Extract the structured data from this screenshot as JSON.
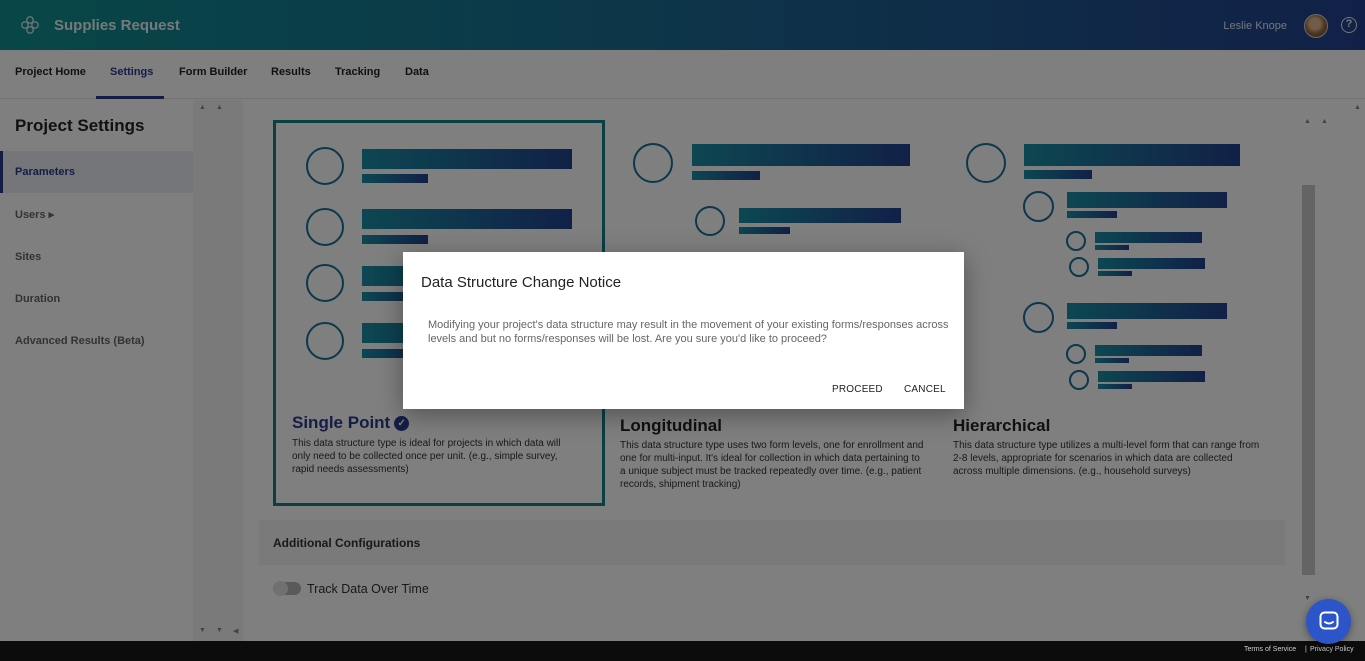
{
  "header": {
    "app_title": "Supplies Request",
    "user_name": "Leslie Knope",
    "help_label": "?"
  },
  "tabs": [
    {
      "label": "Project Home"
    },
    {
      "label": "Settings",
      "active": true
    },
    {
      "label": "Form Builder"
    },
    {
      "label": "Results"
    },
    {
      "label": "Tracking"
    },
    {
      "label": "Data"
    }
  ],
  "sidebar": {
    "title": "Project Settings",
    "items": [
      {
        "label": "Parameters",
        "active": true
      },
      {
        "label": "Users ▸"
      },
      {
        "label": "Sites"
      },
      {
        "label": "Duration"
      },
      {
        "label": "Advanced Results (Beta)"
      }
    ]
  },
  "structures": [
    {
      "title": "Single Point",
      "selected": true,
      "desc": "This data structure type is ideal for projects in which data will only need to be collected once per unit. (e.g., simple survey, rapid needs assessments)"
    },
    {
      "title": "Longitudinal",
      "selected": false,
      "desc": "This data structure type uses two form levels, one for enrollment and one for multi-input. It's ideal for collection in which data pertaining to a unique subject must be tracked repeatedly over time. (e.g., patient records, shipment tracking)"
    },
    {
      "title": "Hierarchical",
      "selected": false,
      "desc": "This data structure type utilizes a multi-level form that can range from 2-8 levels, appropriate for scenarios in which data are collected across multiple dimensions. (e.g., household surveys)"
    }
  ],
  "additional": {
    "heading": "Additional Configurations",
    "toggle_label": "Track Data Over Time",
    "toggle_on": false
  },
  "modal": {
    "title": "Data Structure Change Notice",
    "body": "Modifying your project's data structure may result in the movement of your existing forms/responses across levels and but no forms/responses will be lost. Are you sure you'd like to proceed?",
    "proceed": "PROCEED",
    "cancel": "CANCEL"
  },
  "footer": {
    "terms": "Terms of Service",
    "separator": "|",
    "privacy": "Privacy Policy"
  },
  "colors": {
    "accent": "#2b3b8e",
    "teal": "#147f86",
    "header_start": "#0f8f8e",
    "header_end": "#23418f"
  },
  "icons": {
    "logo": "flower-logo-icon",
    "help": "help-circle-icon",
    "check": "check-circle-icon",
    "chat": "chat-bubble-icon"
  }
}
